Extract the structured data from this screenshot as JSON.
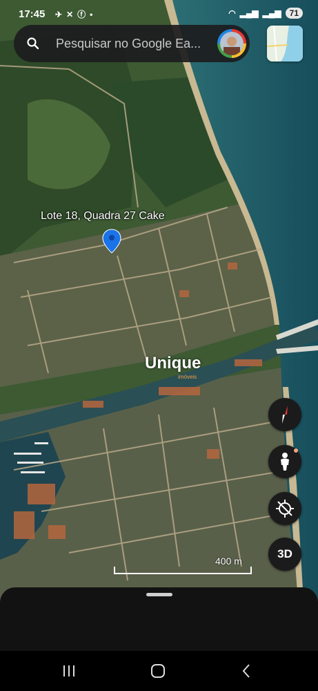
{
  "status_bar": {
    "time": "17:45",
    "battery": "71",
    "left_icons": [
      "airplane-icon",
      "signal-icon",
      "facebook-icon",
      "dot-icon"
    ],
    "right_icons": [
      "wifi-icon",
      "signal-bars-icon",
      "signal-bars-icon"
    ]
  },
  "search": {
    "placeholder": "Pesquisar no Google Ea..."
  },
  "map": {
    "pin_label": "Lote 18, Quadra 27 Cake",
    "watermark": "Unique",
    "watermark_sub": "imóveis",
    "scale_label": "400 m",
    "water_color": "#1f5f6a",
    "land_color": "#3d5a33",
    "pin_color": "#1a73e8"
  },
  "controls": {
    "compass": "compass-icon",
    "pegman": "pegman-icon",
    "my_location": "my-location-icon",
    "three_d_label": "3D"
  },
  "nav": {
    "buttons": [
      "recent-apps-icon",
      "home-icon",
      "back-icon"
    ]
  }
}
